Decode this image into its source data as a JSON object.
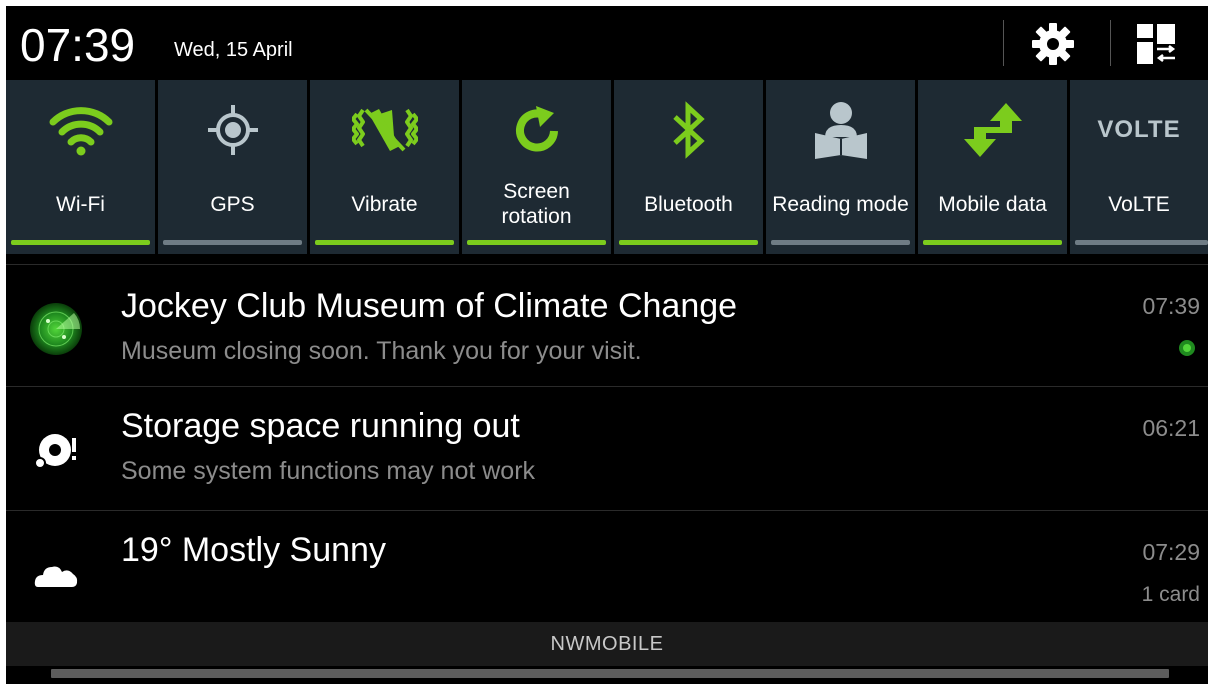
{
  "status": {
    "time": "07:39",
    "date": "Wed, 15 April"
  },
  "colors": {
    "accent_green": "#7ccc1d",
    "tile_bg": "#1e2a33",
    "indicator_off": "#6f7c85",
    "background": "#000000"
  },
  "quick_settings": [
    {
      "label": "Wi-Fi",
      "icon": "wifi-icon",
      "on": true
    },
    {
      "label": "GPS",
      "icon": "gps-icon",
      "on": false
    },
    {
      "label": "Vibrate",
      "icon": "vibrate-icon",
      "on": true
    },
    {
      "label": "Screen rotation",
      "icon": "screen-rotation-icon",
      "on": true
    },
    {
      "label": "Bluetooth",
      "icon": "bluetooth-icon",
      "on": true
    },
    {
      "label": "Reading mode",
      "icon": "reading-mode-icon",
      "on": false
    },
    {
      "label": "Mobile data",
      "icon": "mobile-data-icon",
      "on": true
    },
    {
      "label": "VoLTE",
      "icon": "volte-icon",
      "icon_text": "VOLTE",
      "on": false
    }
  ],
  "notifications": [
    {
      "title": "Jockey Club Museum of Climate Change",
      "subtitle": "Museum closing soon. Thank you for your visit.",
      "time": "07:39",
      "icon": "radar-icon"
    },
    {
      "title": "Storage space running out",
      "subtitle": "Some system functions may not work",
      "time": "06:21",
      "icon": "storage-warning-icon"
    },
    {
      "title": "19° Mostly Sunny",
      "time": "07:29",
      "extra": "1 card",
      "icon": "cloud-icon"
    }
  ],
  "carrier": "NWMOBILE"
}
